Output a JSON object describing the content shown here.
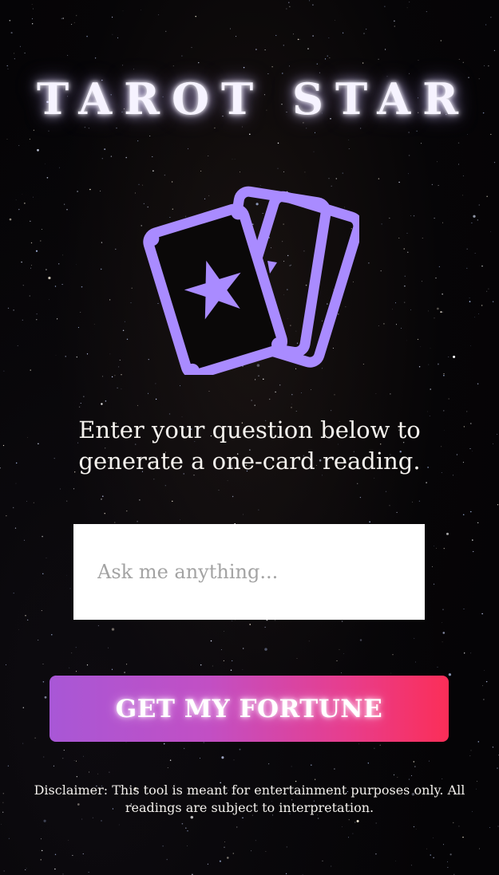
{
  "app": {
    "title": "TAROT STAR"
  },
  "hero": {
    "icon": "tarot-cards-icon",
    "icon_color": "#a98bff"
  },
  "prompt": {
    "text": "Enter your question below to generate a one-card reading."
  },
  "question": {
    "placeholder": "Ask me anything...",
    "value": ""
  },
  "cta": {
    "label": "GET MY FORTUNE",
    "gradient_start": "#a857d6",
    "gradient_end": "#fb2e58"
  },
  "footer": {
    "disclaimer": "Disclaimer: This tool is meant for entertainment purposes only. All readings are subject to interpretation."
  }
}
